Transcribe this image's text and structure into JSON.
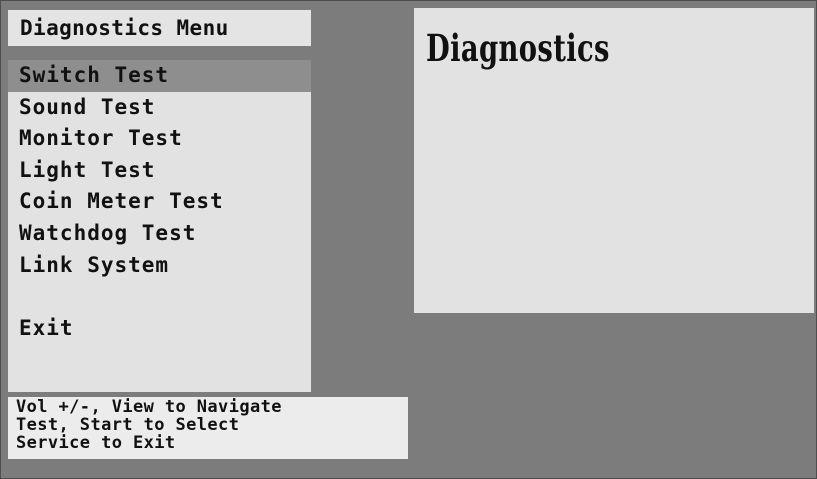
{
  "menu": {
    "title": "Diagnostics Menu",
    "items": [
      {
        "label": "Switch Test",
        "selected": true
      },
      {
        "label": "Sound Test",
        "selected": false
      },
      {
        "label": "Monitor Test",
        "selected": false
      },
      {
        "label": "Light Test",
        "selected": false
      },
      {
        "label": "Coin Meter Test",
        "selected": false
      },
      {
        "label": "Watchdog Test",
        "selected": false
      },
      {
        "label": "Link System",
        "selected": false
      },
      {
        "label": "",
        "selected": false
      },
      {
        "label": "Exit",
        "selected": false
      }
    ]
  },
  "status": {
    "lines": [
      "Vol +/-, View to Navigate",
      "Test, Start to Select",
      "Service to Exit"
    ]
  },
  "display": {
    "title": "Diagnostics"
  },
  "colors": {
    "background": "#7c7c7c",
    "panel": "#e2e2e2",
    "selection": "#8e8e8e",
    "text": "#111111"
  }
}
